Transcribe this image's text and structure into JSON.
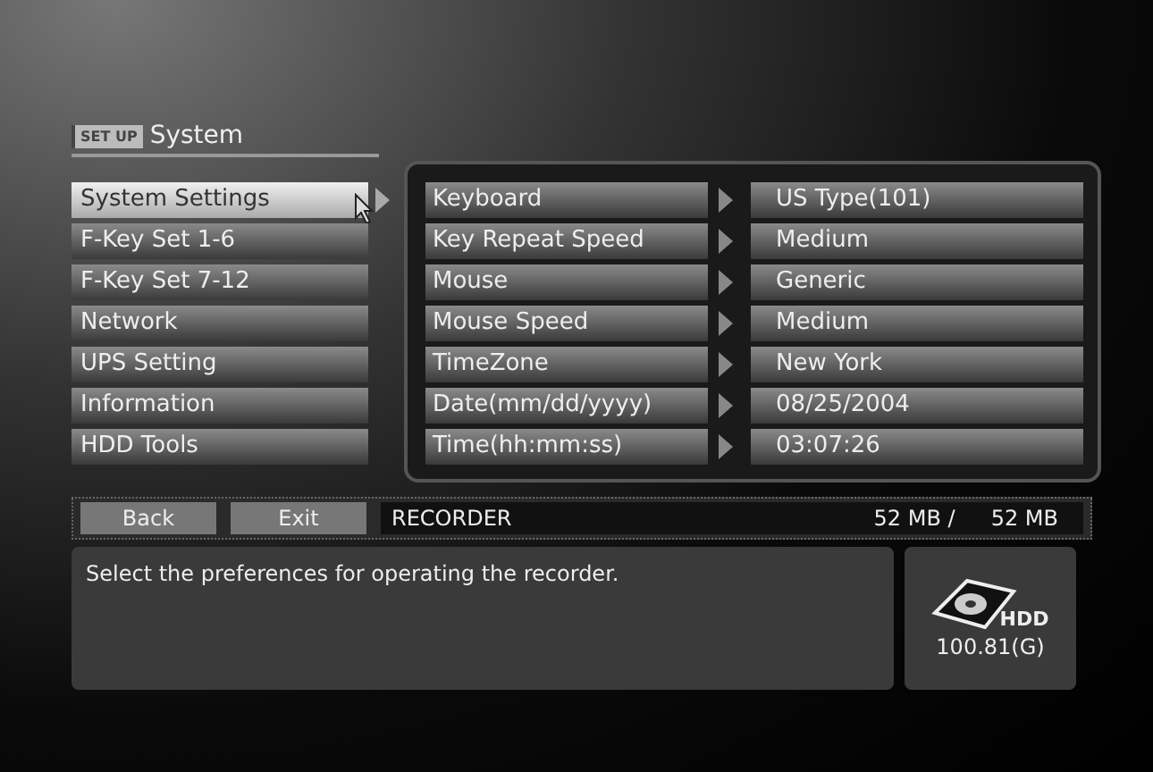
{
  "header": {
    "badge": "SET UP",
    "title": "System"
  },
  "menu": [
    {
      "label": "System Settings",
      "selected": true
    },
    {
      "label": "F-Key Set 1-6",
      "selected": false
    },
    {
      "label": "F-Key Set 7-12",
      "selected": false
    },
    {
      "label": "Network",
      "selected": false
    },
    {
      "label": "UPS Setting",
      "selected": false
    },
    {
      "label": "Information",
      "selected": false
    },
    {
      "label": "HDD Tools",
      "selected": false
    }
  ],
  "settings": [
    {
      "label": "Keyboard",
      "value": "US Type(101)"
    },
    {
      "label": "Key Repeat Speed",
      "value": "Medium"
    },
    {
      "label": "Mouse",
      "value": "Generic"
    },
    {
      "label": "Mouse Speed",
      "value": "Medium"
    },
    {
      "label": "TimeZone",
      "value": "New York"
    },
    {
      "label": "Date(mm/dd/yyyy)",
      "value": "08/25/2004"
    },
    {
      "label": "Time(hh:mm:ss)",
      "value": "03:07:26"
    }
  ],
  "status_bar": {
    "buttons": [
      "Back",
      "Exit"
    ],
    "device": "RECORDER",
    "used": "52 MB /",
    "total": "52 MB"
  },
  "message": "Select the preferences for operating the recorder.",
  "hdd": {
    "label": "HDD",
    "capacity": "100.81(G)"
  }
}
